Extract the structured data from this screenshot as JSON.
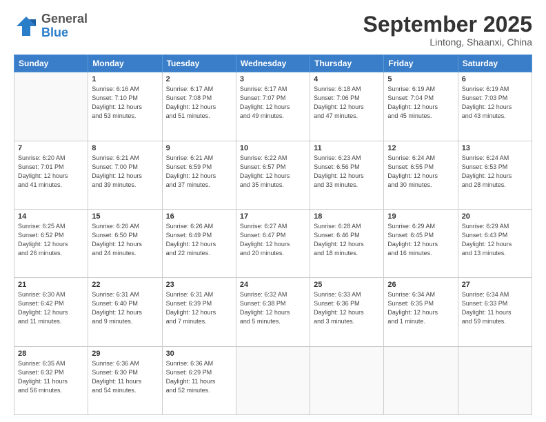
{
  "header": {
    "logo": {
      "line1": "General",
      "line2": "Blue"
    },
    "title": "September 2025",
    "subtitle": "Lintong, Shaanxi, China"
  },
  "weekdays": [
    "Sunday",
    "Monday",
    "Tuesday",
    "Wednesday",
    "Thursday",
    "Friday",
    "Saturday"
  ],
  "weeks": [
    [
      {
        "day": "",
        "info": ""
      },
      {
        "day": "1",
        "info": "Sunrise: 6:16 AM\nSunset: 7:10 PM\nDaylight: 12 hours\nand 53 minutes."
      },
      {
        "day": "2",
        "info": "Sunrise: 6:17 AM\nSunset: 7:08 PM\nDaylight: 12 hours\nand 51 minutes."
      },
      {
        "day": "3",
        "info": "Sunrise: 6:17 AM\nSunset: 7:07 PM\nDaylight: 12 hours\nand 49 minutes."
      },
      {
        "day": "4",
        "info": "Sunrise: 6:18 AM\nSunset: 7:06 PM\nDaylight: 12 hours\nand 47 minutes."
      },
      {
        "day": "5",
        "info": "Sunrise: 6:19 AM\nSunset: 7:04 PM\nDaylight: 12 hours\nand 45 minutes."
      },
      {
        "day": "6",
        "info": "Sunrise: 6:19 AM\nSunset: 7:03 PM\nDaylight: 12 hours\nand 43 minutes."
      }
    ],
    [
      {
        "day": "7",
        "info": "Sunrise: 6:20 AM\nSunset: 7:01 PM\nDaylight: 12 hours\nand 41 minutes."
      },
      {
        "day": "8",
        "info": "Sunrise: 6:21 AM\nSunset: 7:00 PM\nDaylight: 12 hours\nand 39 minutes."
      },
      {
        "day": "9",
        "info": "Sunrise: 6:21 AM\nSunset: 6:59 PM\nDaylight: 12 hours\nand 37 minutes."
      },
      {
        "day": "10",
        "info": "Sunrise: 6:22 AM\nSunset: 6:57 PM\nDaylight: 12 hours\nand 35 minutes."
      },
      {
        "day": "11",
        "info": "Sunrise: 6:23 AM\nSunset: 6:56 PM\nDaylight: 12 hours\nand 33 minutes."
      },
      {
        "day": "12",
        "info": "Sunrise: 6:24 AM\nSunset: 6:55 PM\nDaylight: 12 hours\nand 30 minutes."
      },
      {
        "day": "13",
        "info": "Sunrise: 6:24 AM\nSunset: 6:53 PM\nDaylight: 12 hours\nand 28 minutes."
      }
    ],
    [
      {
        "day": "14",
        "info": "Sunrise: 6:25 AM\nSunset: 6:52 PM\nDaylight: 12 hours\nand 26 minutes."
      },
      {
        "day": "15",
        "info": "Sunrise: 6:26 AM\nSunset: 6:50 PM\nDaylight: 12 hours\nand 24 minutes."
      },
      {
        "day": "16",
        "info": "Sunrise: 6:26 AM\nSunset: 6:49 PM\nDaylight: 12 hours\nand 22 minutes."
      },
      {
        "day": "17",
        "info": "Sunrise: 6:27 AM\nSunset: 6:47 PM\nDaylight: 12 hours\nand 20 minutes."
      },
      {
        "day": "18",
        "info": "Sunrise: 6:28 AM\nSunset: 6:46 PM\nDaylight: 12 hours\nand 18 minutes."
      },
      {
        "day": "19",
        "info": "Sunrise: 6:29 AM\nSunset: 6:45 PM\nDaylight: 12 hours\nand 16 minutes."
      },
      {
        "day": "20",
        "info": "Sunrise: 6:29 AM\nSunset: 6:43 PM\nDaylight: 12 hours\nand 13 minutes."
      }
    ],
    [
      {
        "day": "21",
        "info": "Sunrise: 6:30 AM\nSunset: 6:42 PM\nDaylight: 12 hours\nand 11 minutes."
      },
      {
        "day": "22",
        "info": "Sunrise: 6:31 AM\nSunset: 6:40 PM\nDaylight: 12 hours\nand 9 minutes."
      },
      {
        "day": "23",
        "info": "Sunrise: 6:31 AM\nSunset: 6:39 PM\nDaylight: 12 hours\nand 7 minutes."
      },
      {
        "day": "24",
        "info": "Sunrise: 6:32 AM\nSunset: 6:38 PM\nDaylight: 12 hours\nand 5 minutes."
      },
      {
        "day": "25",
        "info": "Sunrise: 6:33 AM\nSunset: 6:36 PM\nDaylight: 12 hours\nand 3 minutes."
      },
      {
        "day": "26",
        "info": "Sunrise: 6:34 AM\nSunset: 6:35 PM\nDaylight: 12 hours\nand 1 minute."
      },
      {
        "day": "27",
        "info": "Sunrise: 6:34 AM\nSunset: 6:33 PM\nDaylight: 11 hours\nand 59 minutes."
      }
    ],
    [
      {
        "day": "28",
        "info": "Sunrise: 6:35 AM\nSunset: 6:32 PM\nDaylight: 11 hours\nand 56 minutes."
      },
      {
        "day": "29",
        "info": "Sunrise: 6:36 AM\nSunset: 6:30 PM\nDaylight: 11 hours\nand 54 minutes."
      },
      {
        "day": "30",
        "info": "Sunrise: 6:36 AM\nSunset: 6:29 PM\nDaylight: 11 hours\nand 52 minutes."
      },
      {
        "day": "",
        "info": ""
      },
      {
        "day": "",
        "info": ""
      },
      {
        "day": "",
        "info": ""
      },
      {
        "day": "",
        "info": ""
      }
    ]
  ]
}
